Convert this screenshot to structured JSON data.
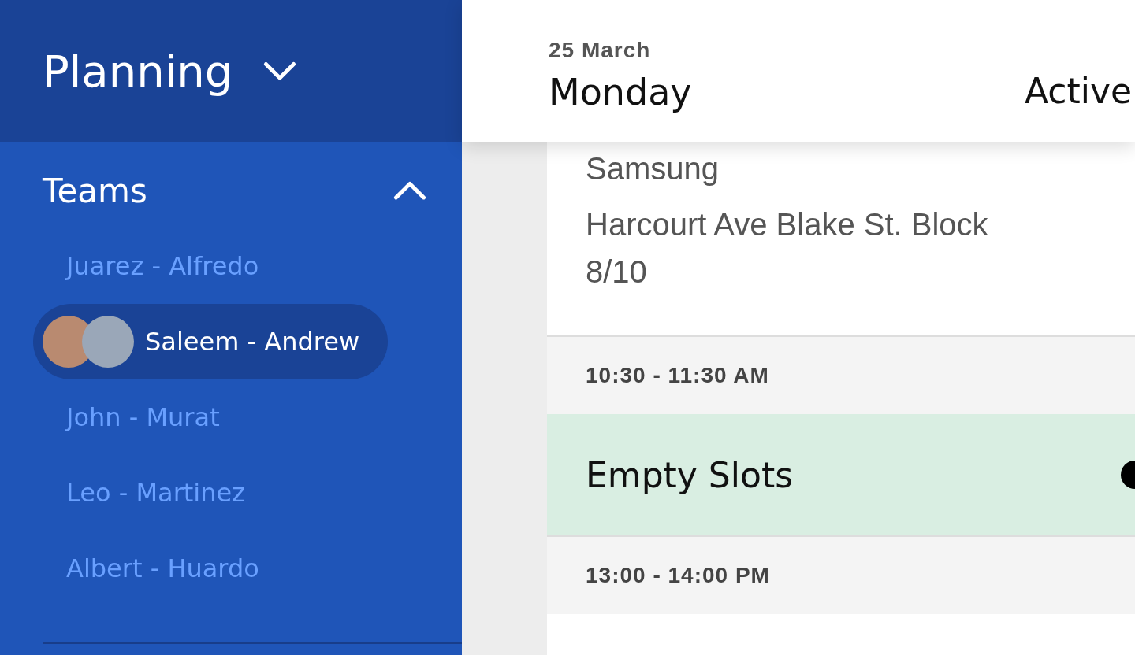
{
  "sidebar": {
    "title": "Planning",
    "section": {
      "label": "Teams",
      "expanded": true
    },
    "teams": [
      {
        "label": "Juarez - Alfredo",
        "selected": false
      },
      {
        "label": "Saleem - Andrew",
        "selected": true
      },
      {
        "label": "John - Murat",
        "selected": false
      },
      {
        "label": "Leo - Martinez",
        "selected": false
      },
      {
        "label": "Albert - Huardo",
        "selected": false
      }
    ]
  },
  "header": {
    "date": "25 March",
    "day": "Monday",
    "status": "Active"
  },
  "schedule": [
    {
      "kind": "job",
      "company": "Samsung",
      "address": "Harcourt Ave Blake St. Block 8/10"
    },
    {
      "kind": "time",
      "label": "10:30 - 11:30 AM"
    },
    {
      "kind": "empty",
      "label": "Empty Slots"
    },
    {
      "kind": "time",
      "label": "13:00 - 14:00 PM"
    }
  ]
}
